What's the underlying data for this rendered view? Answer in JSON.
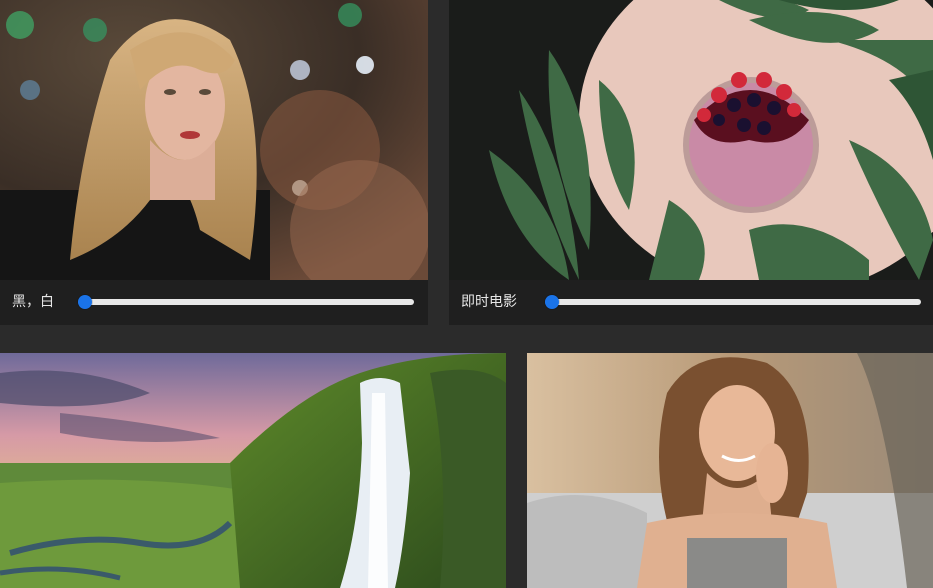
{
  "cards": [
    {
      "name": "portrait-blonde",
      "filter_label": "黑，白",
      "slider_value": 0
    },
    {
      "name": "berry-smoothie",
      "filter_label": "即时电影",
      "slider_value": 0
    },
    {
      "name": "waterfall-landscape"
    },
    {
      "name": "portrait-brunette"
    }
  ],
  "colors": {
    "page_background": "#2b2b2b",
    "control_bar": "#1f1f1f",
    "slider_track": "#e8e8e8",
    "slider_thumb": "#1a73e8",
    "label_text": "#e6e6e6"
  }
}
